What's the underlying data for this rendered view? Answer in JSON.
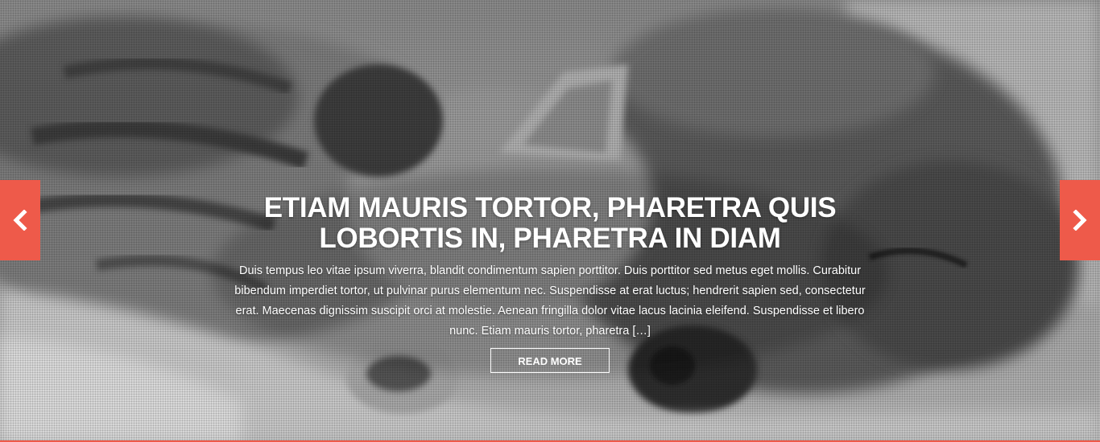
{
  "slide": {
    "title": "ETIAM MAURIS TORTOR, PHARETRA QUIS LOBORTIS IN, PHARETRA IN DIAM",
    "excerpt": "Duis tempus leo vitae ipsum viverra, blandit condimentum sapien porttitor. Duis porttitor sed metus eget mollis. Curabitur bibendum imperdiet tortor, ut pulvinar purus elementum nec. Suspendisse at erat luctus; hendrerit sapien sed, consectetur erat. Maecenas dignissim suscipit orci at molestie. Aenean fringilla dolor vitae lacus lacinia eleifend. Suspendisse et libero nunc. Etiam mauris tortor, pharetra […]",
    "read_more_label": "READ MORE",
    "background_image": "sleeping-cat-and-dog-grayscale-photo"
  },
  "controls": {
    "prev_icon": "chevron-left-icon",
    "next_icon": "chevron-right-icon"
  },
  "colors": {
    "accent": "#ee5a4a",
    "text": "#ffffff"
  }
}
